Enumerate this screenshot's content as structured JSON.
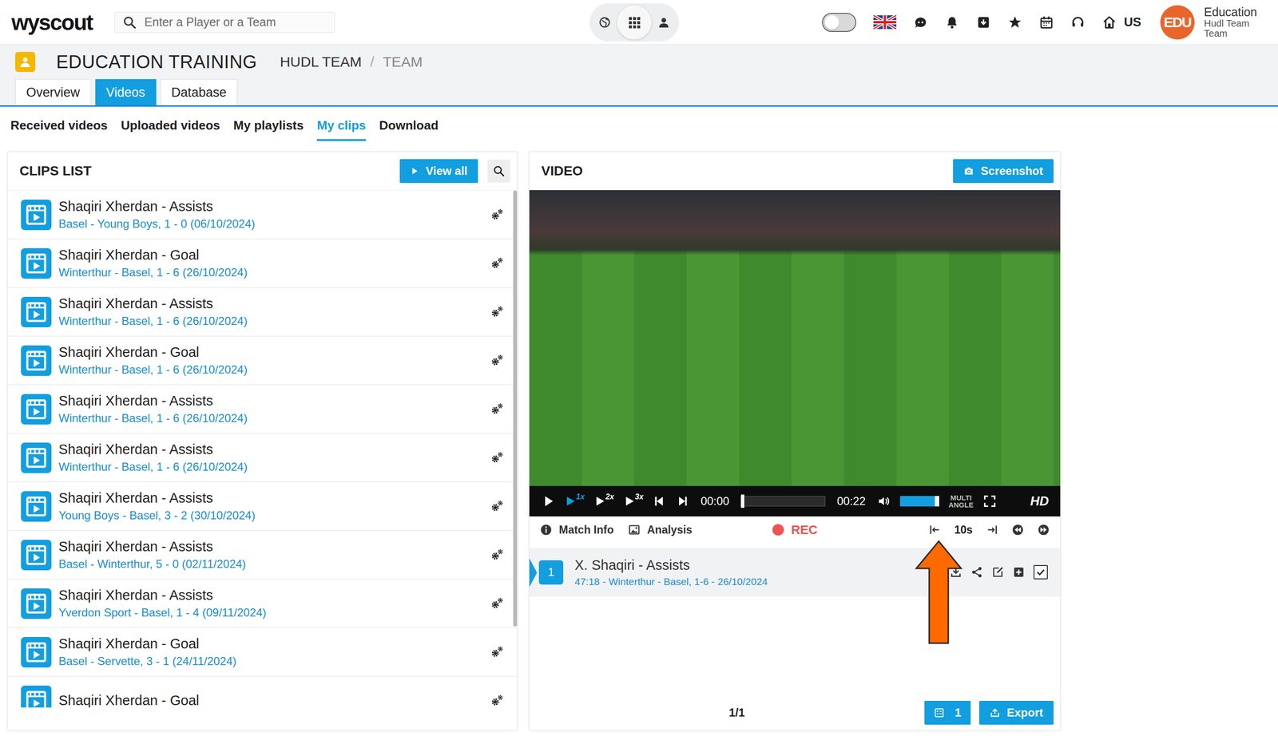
{
  "header": {
    "logo": "wyscout",
    "search": {
      "placeholder": "Enter a Player or a Team"
    },
    "apps": [
      {
        "kind": "globe",
        "selected": false
      },
      {
        "kind": "grid",
        "selected": true
      },
      {
        "kind": "person",
        "selected": false
      }
    ],
    "toggle": {
      "on": false
    },
    "region": "US",
    "user": {
      "avatar": "EDU",
      "name": "Education",
      "org": "Hudl Team",
      "role": "Team"
    }
  },
  "page": {
    "title": "EDUCATION TRAINING",
    "breadcrumb": [
      "HUDL TEAM",
      "TEAM"
    ],
    "separator": "/"
  },
  "tabs": [
    {
      "label": "Overview",
      "selected": false
    },
    {
      "label": "Videos",
      "selected": true
    },
    {
      "label": "Database",
      "selected": false
    }
  ],
  "subtabs": [
    {
      "label": "Received videos",
      "selected": false
    },
    {
      "label": "Uploaded videos",
      "selected": false
    },
    {
      "label": "My playlists",
      "selected": false
    },
    {
      "label": "My clips",
      "selected": true
    },
    {
      "label": "Download",
      "selected": false
    }
  ],
  "clips_list": {
    "title": "CLIPS LIST",
    "view_all": "View all",
    "items": [
      {
        "title": "Shaqiri Xherdan - Assists",
        "match": "Basel - Young Boys, 1 - 0 (06/10/2024)"
      },
      {
        "title": "Shaqiri Xherdan - Goal",
        "match": "Winterthur - Basel, 1 - 6 (26/10/2024)"
      },
      {
        "title": "Shaqiri Xherdan - Assists",
        "match": "Winterthur - Basel, 1 - 6 (26/10/2024)"
      },
      {
        "title": "Shaqiri Xherdan - Goal",
        "match": "Winterthur - Basel, 1 - 6 (26/10/2024)"
      },
      {
        "title": "Shaqiri Xherdan - Assists",
        "match": "Winterthur - Basel, 1 - 6 (26/10/2024)"
      },
      {
        "title": "Shaqiri Xherdan - Assists",
        "match": "Winterthur - Basel, 1 - 6 (26/10/2024)"
      },
      {
        "title": "Shaqiri Xherdan - Assists",
        "match": "Young Boys - Basel, 3 - 2 (30/10/2024)"
      },
      {
        "title": "Shaqiri Xherdan - Assists",
        "match": "Basel - Winterthur, 5 - 0 (02/11/2024)"
      },
      {
        "title": "Shaqiri Xherdan - Assists",
        "match": "Yverdon Sport - Basel, 1 - 4 (09/11/2024)"
      },
      {
        "title": "Shaqiri Xherdan - Goal",
        "match": "Basel - Servette, 3 - 1 (24/11/2024)"
      },
      {
        "title": "Shaqiri Xherdan - Goal",
        "match": ""
      }
    ]
  },
  "video": {
    "title": "VIDEO",
    "screenshot": "Screenshot",
    "speeds": [
      {
        "label": "1x",
        "selected": true
      },
      {
        "label": "2x",
        "selected": false
      },
      {
        "label": "3x",
        "selected": false
      }
    ],
    "time": "00:00",
    "duration": "00:22",
    "progress": 0,
    "volume": 0.9,
    "multi_angle": "MULTI ANGLE",
    "hd": "HD",
    "toolbar": {
      "match_info": "Match Info",
      "analysis": "Analysis",
      "rec": "REC",
      "step": "10s"
    },
    "clips": [
      {
        "number": "1",
        "title": "X. Shaqiri - Assists",
        "meta": "47:18 - Winterthur - Basel, 1-6 - 26/10/2024",
        "selected": true,
        "checked": true
      }
    ],
    "pager": "1/1",
    "selected_count": "1",
    "export": "Export"
  }
}
